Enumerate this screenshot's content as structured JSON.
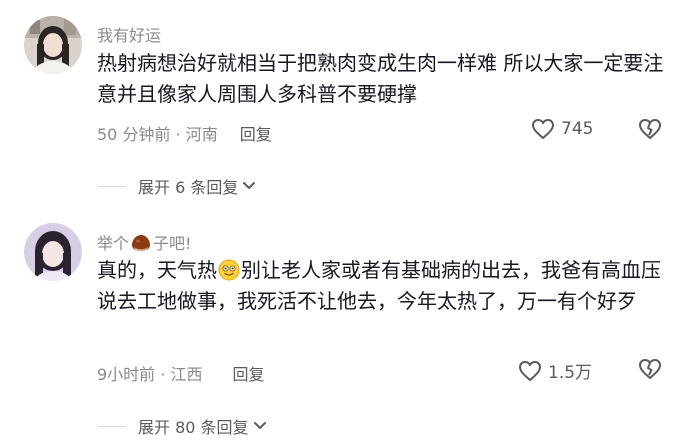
{
  "comments": [
    {
      "username": "我有好运",
      "text": "热射病想治好就相当于把熟肉变成生肉一样难 所以大家一定要注意并且像家人周围人多科普不要硬撑",
      "time": "50 分钟前 · 河南",
      "reply_label": "回复",
      "likes": "745",
      "expand_label": "展开 6 条回复"
    },
    {
      "username_before": "举个",
      "username_after": "子吧!",
      "username_icon": "chestnut-icon",
      "text_before": "真的，天气热",
      "text_emoji": "smiling-face-emoji",
      "text_after": "别让老人家或者有基础病的出去，我爸有高血压说去工地做事，我死活不让他去，今年太热了，万一有个好歹",
      "time": "9小时前 · 江西",
      "reply_label": "回复",
      "likes": "1.5万",
      "expand_label": "展开 80 条回复"
    }
  ],
  "colors": {
    "primary_text": "#161823",
    "secondary_text": "#8a8a8f",
    "icon": "#5a5a60",
    "divider": "#d8d8dc"
  }
}
